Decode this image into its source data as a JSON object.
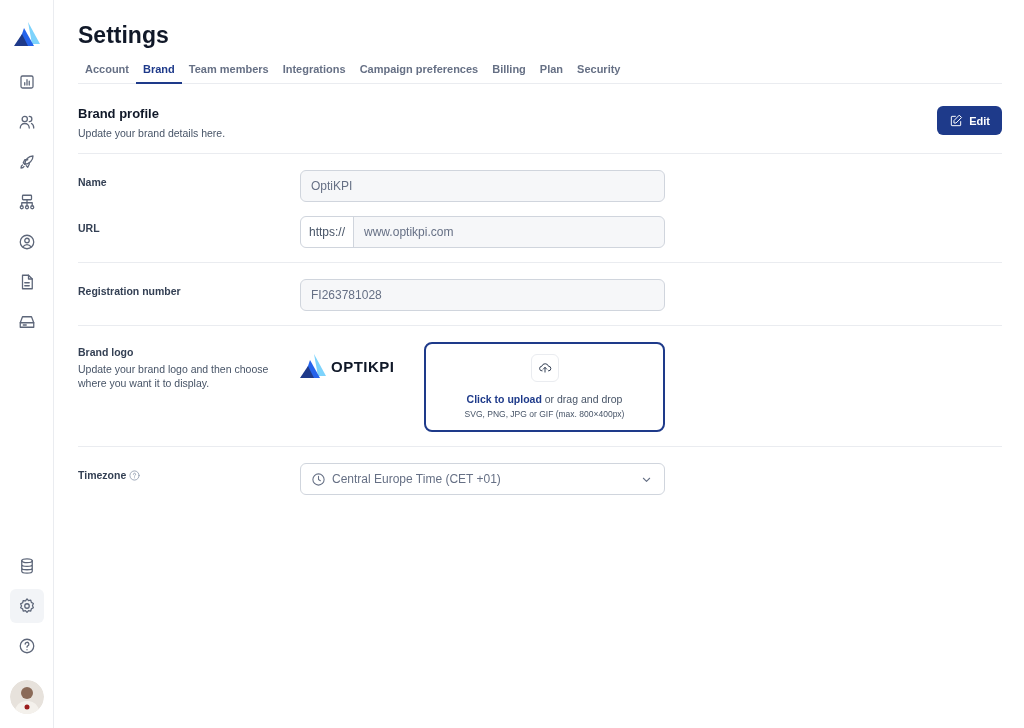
{
  "sidebar": {
    "items": [
      {
        "kind": "chart",
        "selected": false
      },
      {
        "kind": "users",
        "selected": false
      },
      {
        "kind": "rocket",
        "selected": false
      },
      {
        "kind": "hierarchy",
        "selected": false
      },
      {
        "kind": "user-circle",
        "selected": false
      },
      {
        "kind": "document",
        "selected": false
      },
      {
        "kind": "drive",
        "selected": false
      }
    ],
    "bottom_items": [
      {
        "kind": "database",
        "selected": false
      },
      {
        "kind": "settings",
        "selected": true
      },
      {
        "kind": "help",
        "selected": false
      }
    ]
  },
  "title": "Settings",
  "tabs": [
    {
      "label": "Account",
      "selected": false
    },
    {
      "label": "Brand",
      "selected": true
    },
    {
      "label": "Team members",
      "selected": false
    },
    {
      "label": "Integrations",
      "selected": false
    },
    {
      "label": "Campaign preferences",
      "selected": false
    },
    {
      "label": "Billing",
      "selected": false
    },
    {
      "label": "Plan",
      "selected": false
    },
    {
      "label": "Security",
      "selected": false
    }
  ],
  "section": {
    "title": "Brand profile",
    "subtitle": "Update your brand details here.",
    "edit_button": "Edit"
  },
  "name": {
    "label": "Name",
    "value": "OptiKPI"
  },
  "url": {
    "label": "URL",
    "prefix": "https://",
    "value": "www.optikpi.com"
  },
  "registration": {
    "label": "Registration number",
    "value": "FI263781028"
  },
  "logo": {
    "label": "Brand logo",
    "description": "Update your brand logo and then choose where you want it to display.",
    "logo_text": "OPTIKPI",
    "upload_link": "Click to upload",
    "upload_text": "or drag and drop",
    "upload_hint": "SVG, PNG, JPG or GIF (max. 800×400px)"
  },
  "timezone": {
    "label": "Timezone",
    "value": "Central Europe Time (CET +01)"
  }
}
